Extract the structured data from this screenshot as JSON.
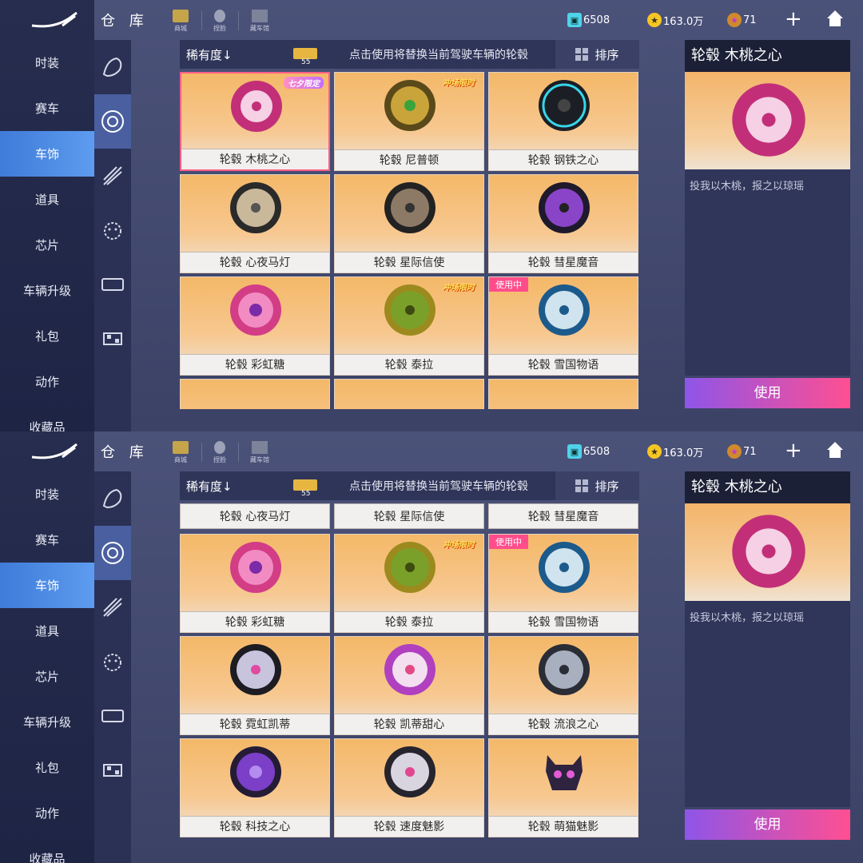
{
  "header": {
    "title": "仓 库",
    "quick_links": [
      "商城",
      "捏脸",
      "藏车馆"
    ],
    "currencies": {
      "coupon": "6508",
      "coins": "163.0万",
      "stars": "71"
    }
  },
  "nav": [
    "时装",
    "赛车",
    "车饰",
    "道具",
    "芯片",
    "车辆升级",
    "礼包",
    "动作",
    "收藏品"
  ],
  "active_nav": "车饰",
  "toolbar": {
    "rarity_label": "稀有度↓",
    "ticket_count": "55",
    "hint": "点击使用将替换当前驾驶车辆的轮毂",
    "sort_label": "排序"
  },
  "detail": {
    "title": "轮毂 木桃之心",
    "description": "投我以木桃，报之以琼瑶",
    "use_button": "使用"
  },
  "badge_in_use": "使用中",
  "tags": {
    "limited": "七夕限定",
    "event": "冲场限时"
  },
  "colors": {
    "accent_pink": "#ff4d8b",
    "active_nav": "#4a8ae6",
    "use_gradient_start": "#8e55e8",
    "use_gradient_end": "#ff4f92"
  },
  "screen1_items": [
    "轮毂 木桃之心",
    "轮毂 尼普顿",
    "轮毂 钢铁之心",
    "轮毂 心夜马灯",
    "轮毂 星际信使",
    "轮毂 彗星魔音",
    "轮毂 彩虹糖",
    "轮毂 泰拉",
    "轮毂 雪国物语"
  ],
  "screen2_top_row": [
    "轮毂 心夜马灯",
    "轮毂 星际信使",
    "轮毂 彗星魔音"
  ],
  "screen2_items": [
    "轮毂 彩虹糖",
    "轮毂 泰拉",
    "轮毂 雪国物语",
    "轮毂 霓虹凯蒂",
    "轮毂 凯蒂甜心",
    "轮毂 流浪之心",
    "轮毂 科技之心",
    "轮毂 速度魅影",
    "轮毂 萌猫魅影"
  ]
}
